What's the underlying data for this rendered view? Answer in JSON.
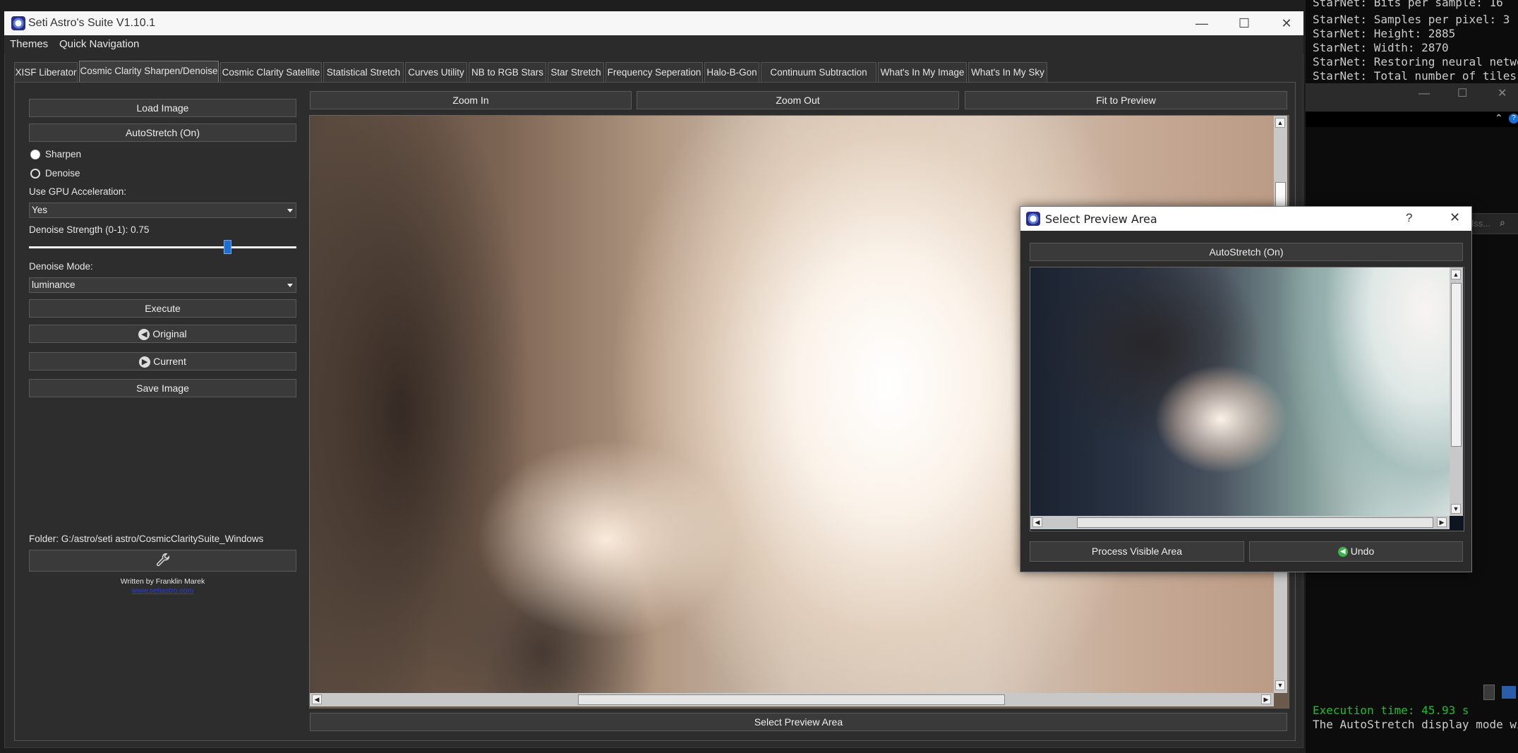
{
  "window": {
    "title": "Seti Astro's Suite V1.10.1",
    "controls": {
      "minimize": "—",
      "maximize": "☐",
      "close": "✕"
    }
  },
  "menu": {
    "themes": "Themes",
    "quick_navigation": "Quick Navigation"
  },
  "tabs": [
    {
      "label": "XISF Liberator"
    },
    {
      "label": "Cosmic Clarity Sharpen/Denoise",
      "active": true
    },
    {
      "label": "Cosmic Clarity Satellite"
    },
    {
      "label": "Statistical Stretch"
    },
    {
      "label": "Curves Utility"
    },
    {
      "label": "NB to RGB Stars"
    },
    {
      "label": "Star Stretch"
    },
    {
      "label": "Frequency Seperation"
    },
    {
      "label": "Halo-B-Gon"
    },
    {
      "label": "Continuum Subtraction"
    },
    {
      "label": "What's In My Image"
    },
    {
      "label": "What's In My Sky"
    }
  ],
  "left_panel": {
    "load_image": "Load Image",
    "autostretch": "AutoStretch (On)",
    "mode_sharpen": "Sharpen",
    "mode_denoise": "Denoise",
    "selected_mode": "Denoise",
    "gpu_label": "Use GPU Acceleration:",
    "gpu_value": "Yes",
    "denoise_strength_label": "Denoise Strength (0-1): 0.75",
    "denoise_strength": 0.75,
    "denoise_mode_label": "Denoise Mode:",
    "denoise_mode_value": "luminance",
    "execute": "Execute",
    "original": "Original",
    "current": "Current",
    "save_image": "Save Image",
    "folder": "Folder: G:/astro/seti astro/CosmicClaritySuite_Windows",
    "wrench_icon": "wrench-icon",
    "credit": "Written by Franklin Marek",
    "link": "www.setiastro.com"
  },
  "preview": {
    "zoom_in": "Zoom In",
    "zoom_out": "Zoom Out",
    "fit": "Fit to Preview",
    "select_preview_area": "Select Preview Area"
  },
  "dialog": {
    "title": "Select Preview Area",
    "help": "?",
    "close": "✕",
    "autostretch": "AutoStretch (On)",
    "process_visible": "Process Visible Area",
    "undo": "Undo"
  },
  "terminal": {
    "lines": [
      "StarNet: Bits per sample: 16",
      "StarNet: Samples per pixel: 3",
      "StarNet: Height: 2885",
      "StarNet: Width: 2870",
      "StarNet: Restoring neural network",
      "StarNet: Total number of tiles:"
    ],
    "execution_time": "Execution time: 45.93 s",
    "autostretch_note": "The AutoStretch display mode will",
    "search_placeholder": "dss..."
  },
  "colors": {
    "accent": "#1d6fd6",
    "terminal_green": "#13c32a",
    "panel_bg": "#2b2b2b"
  }
}
